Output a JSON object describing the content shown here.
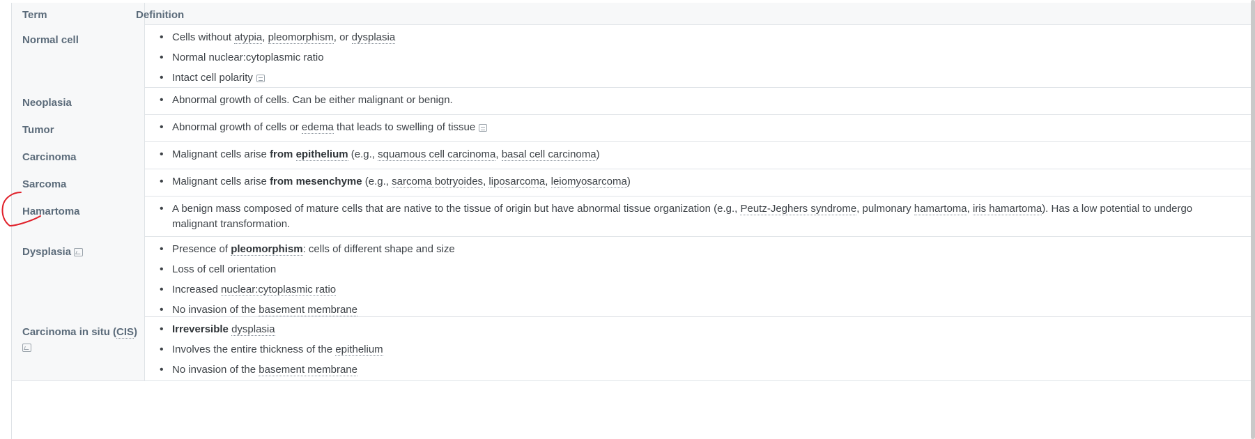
{
  "header": {
    "term": "Term",
    "definition": "Definition"
  },
  "rows": [
    {
      "term": "Normal cell",
      "items": [
        [
          "Cells without ",
          "atypia",
          ", ",
          "pleomorphism",
          ", or ",
          "dysplasia"
        ],
        [
          "Normal nuclear:cytoplasmic ratio"
        ],
        [
          "Intact cell polarity"
        ]
      ]
    },
    {
      "term": "Neoplasia",
      "items": [
        [
          "Abnormal growth of cells. Can be either malignant or benign."
        ]
      ]
    },
    {
      "term": "Tumor",
      "items": [
        [
          "Abnormal growth of cells or ",
          "edema",
          " that leads to swelling of tissue"
        ]
      ]
    },
    {
      "term": "Carcinoma",
      "items": [
        [
          "Malignant cells arise ",
          "from ",
          "epithelium",
          " (e.g., ",
          "squamous cell carcinoma",
          ", ",
          "basal cell carcinoma",
          ")"
        ]
      ]
    },
    {
      "term": "Sarcoma",
      "items": [
        [
          "Malignant cells arise ",
          "from mesenchyme",
          " (e.g., ",
          "sarcoma botryoides",
          ", ",
          "liposarcoma",
          ", ",
          "leiomyosarcoma",
          ")"
        ]
      ]
    },
    {
      "term": "Hamartoma",
      "items": [
        [
          "A benign mass composed of mature cells that are native to the tissue of origin but have abnormal tissue organization (e.g., ",
          "Peutz-Jeghers syndrome",
          ", pulmonary ",
          "hamartoma",
          ", ",
          "iris hamartoma",
          "). Has a low potential to undergo malignant transformation."
        ]
      ]
    },
    {
      "term": "Dysplasia",
      "items": [
        [
          "Presence of ",
          "pleomorphism",
          ": cells of different shape and size"
        ],
        [
          "Loss of cell orientation"
        ],
        [
          "Increased ",
          "nuclear:cytoplasmic ratio"
        ],
        [
          "No invasion of the ",
          "basement membrane"
        ]
      ]
    },
    {
      "term": "Carcinoma in situ (",
      "term_abbr": "CIS",
      "term_end": ")",
      "items": [
        [
          "Irreversible",
          " ",
          "dysplasia"
        ],
        [
          "Involves the entire thickness of the ",
          "epithelium"
        ],
        [
          "No invasion of the ",
          "basement membrane"
        ]
      ]
    }
  ],
  "icons": {
    "note": "note-icon",
    "image": "image-icon"
  },
  "annotation": {
    "color": "#e0202a"
  }
}
